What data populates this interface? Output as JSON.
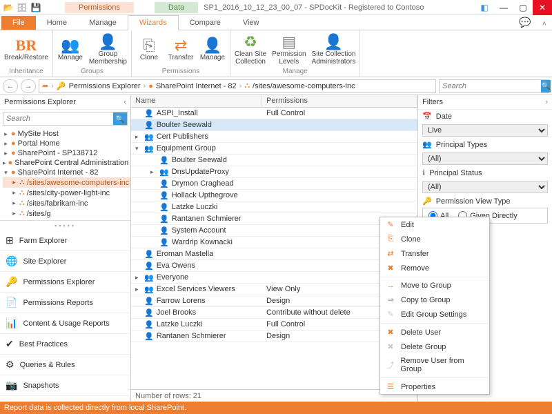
{
  "title": "SP1_2016_10_12_23_00_07 - SPDocKit - Registered to Contoso",
  "prefixTabs": {
    "perm": "Permissions",
    "data": "Data"
  },
  "ribbonTabs": {
    "file": "File",
    "home": "Home",
    "manage": "Manage",
    "wizards": "Wizards",
    "compare": "Compare",
    "view": "View"
  },
  "ribbon": {
    "inheritance": {
      "name": "Inheritance",
      "breakRestore": "Break/Restore"
    },
    "groups": {
      "name": "Groups",
      "manage": "Manage",
      "groupMembership": "Group\nMembership"
    },
    "permissions": {
      "name": "Permissions",
      "clone": "Clone",
      "transfer": "Transfer",
      "manage": "Manage"
    },
    "manage": {
      "name": "Manage",
      "cleanSite": "Clean Site\nCollection",
      "permLevels": "Permission\nLevels",
      "siteAdmins": "Site Collection\nAdministrators"
    }
  },
  "breadcrumb": [
    "Permissions Explorer",
    "SharePoint Internet - 82",
    "/sites/awesome-computers-inc"
  ],
  "searchPlaceholder": "Search",
  "leftPanel": {
    "title": "Permissions Explorer",
    "tree": [
      {
        "label": "MySite Host",
        "tw": "▸"
      },
      {
        "label": "Portal Home",
        "tw": "▸"
      },
      {
        "label": "SharePoint - SP138712",
        "tw": "▸"
      },
      {
        "label": "SharePoint Central Administration v",
        "tw": "▸"
      },
      {
        "label": "SharePoint Internet - 82",
        "tw": "▾",
        "children": [
          {
            "label": "/sites/awesome-computers-inc",
            "sel": true,
            "tw": "▸"
          },
          {
            "label": "/sites/city-power-light-inc",
            "tw": "▸"
          },
          {
            "label": "/sites/fabrikam-inc",
            "tw": "▸"
          },
          {
            "label": "/sites/g",
            "tw": "▸"
          }
        ]
      }
    ],
    "cats": [
      {
        "label": "Farm Explorer",
        "ic": "⊞"
      },
      {
        "label": "Site Explorer",
        "ic": "🌐"
      },
      {
        "label": "Permissions Explorer",
        "ic": "🔑",
        "active": true
      },
      {
        "label": "Permissions Reports",
        "ic": "📄"
      },
      {
        "label": "Content & Usage Reports",
        "ic": "📊"
      },
      {
        "label": "Best Practices",
        "ic": "✔"
      },
      {
        "label": "Queries & Rules",
        "ic": "⚙"
      },
      {
        "label": "Snapshots",
        "ic": "📷"
      }
    ]
  },
  "grid": {
    "cols": {
      "name": "Name",
      "perm": "Permissions"
    },
    "rows": [
      {
        "n": "ASPI_Install",
        "p": "Full Control",
        "ic": "u",
        "tw": ""
      },
      {
        "n": "Boulter Seewald",
        "p": "",
        "ic": "u",
        "tw": "",
        "sel": true
      },
      {
        "n": "Cert Publishers",
        "p": "",
        "ic": "g",
        "tw": "▸"
      },
      {
        "n": "Equipment Group",
        "p": "",
        "ic": "g",
        "tw": "▾"
      },
      {
        "n": "Boulter Seewald",
        "p": "",
        "ic": "u",
        "tw": "",
        "nested": true
      },
      {
        "n": "DnsUpdateProxy",
        "p": "",
        "ic": "g",
        "tw": "▸",
        "nested": true
      },
      {
        "n": "Drymon Craghead",
        "p": "",
        "ic": "u",
        "tw": "",
        "nested": true
      },
      {
        "n": "Hollack Upthegrove",
        "p": "",
        "ic": "u",
        "tw": "",
        "nested": true
      },
      {
        "n": "Latzke Luczki",
        "p": "",
        "ic": "u",
        "tw": "",
        "nested": true
      },
      {
        "n": "Rantanen Schmierer",
        "p": "",
        "ic": "u",
        "tw": "",
        "nested": true
      },
      {
        "n": "System Account",
        "p": "",
        "ic": "u",
        "tw": "",
        "nested": true
      },
      {
        "n": "Wardrip Kownacki",
        "p": "",
        "ic": "u",
        "tw": "",
        "nested": true
      },
      {
        "n": "Eroman Mastella",
        "p": "",
        "ic": "u",
        "tw": ""
      },
      {
        "n": "Eva Owens",
        "p": "",
        "ic": "u",
        "tw": ""
      },
      {
        "n": "Everyone",
        "p": "",
        "ic": "g",
        "tw": "▸"
      },
      {
        "n": "Excel Services Viewers",
        "p": "View Only",
        "ic": "g",
        "tw": "▸"
      },
      {
        "n": "Farrow Lorens",
        "p": "Design",
        "ic": "u",
        "tw": ""
      },
      {
        "n": "Joel Brooks",
        "p": "Contribute without delete",
        "ic": "u",
        "tw": ""
      },
      {
        "n": "Latzke Luczki",
        "p": "Full Control",
        "ic": "u",
        "tw": ""
      },
      {
        "n": "Rantanen Schmierer",
        "p": "Design",
        "ic": "u",
        "tw": ""
      }
    ],
    "footer": "Number of rows: 21"
  },
  "ctx": [
    {
      "label": "Edit",
      "ic": "✎"
    },
    {
      "label": "Clone",
      "ic": "⎘"
    },
    {
      "label": "Transfer",
      "ic": "⇄"
    },
    {
      "label": "Remove",
      "ic": "✖"
    },
    {
      "sep": true
    },
    {
      "label": "Move to Group",
      "ic": "→"
    },
    {
      "label": "Copy to Group",
      "ic": "⇒"
    },
    {
      "label": "Edit Group Settings",
      "ic": "✎",
      "dis": true
    },
    {
      "sep": true
    },
    {
      "label": "Delete User",
      "ic": "✖"
    },
    {
      "label": "Delete Group",
      "ic": "✖",
      "dis": true
    },
    {
      "label": "Remove User from Group",
      "ic": "⤴",
      "dis": true
    },
    {
      "sep": true
    },
    {
      "label": "Properties",
      "ic": "☰"
    }
  ],
  "filters": {
    "title": "Filters",
    "date": {
      "label": "Date",
      "value": "Live"
    },
    "ptypes": {
      "label": "Principal Types",
      "value": "(All)"
    },
    "pstatus": {
      "label": "Principal Status",
      "value": "(All)"
    },
    "viewType": {
      "label": "Permission View Type",
      "all": "All",
      "given": "Given Directly"
    }
  },
  "status": "Report data is collected directly from local SharePoint."
}
